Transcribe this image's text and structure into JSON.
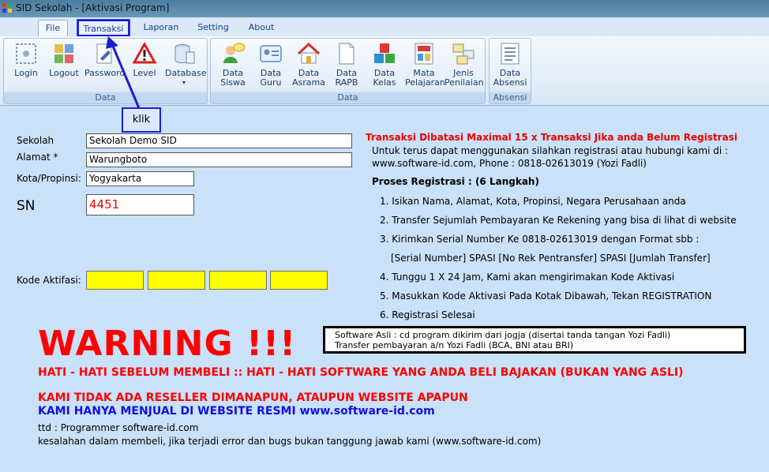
{
  "window": {
    "title": "SID Sekolah - [Aktivasi Program]"
  },
  "tabs": [
    "File",
    "Transaksi",
    "Laporan",
    "Setting",
    "About"
  ],
  "ribbon": {
    "group_data_1": {
      "label": "Data",
      "buttons": [
        "Login",
        "Logout",
        "Password",
        "Level",
        "Database"
      ]
    },
    "group_data_2": {
      "label": "Data",
      "buttons": [
        {
          "l1": "Data",
          "l2": "Siswa"
        },
        {
          "l1": "Data",
          "l2": "Guru"
        },
        {
          "l1": "Data",
          "l2": "Asrama"
        },
        {
          "l1": "Data",
          "l2": "RAPB"
        },
        {
          "l1": "Data",
          "l2": "Kelas"
        },
        {
          "l1": "Mata",
          "l2": "Pelajaran"
        },
        {
          "l1": "Jenis",
          "l2": "Penilaian"
        }
      ]
    },
    "group_absensi": {
      "label": "Absensi",
      "button": {
        "l1": "Data",
        "l2": "Absensi"
      }
    }
  },
  "callout": {
    "text": "klik"
  },
  "form": {
    "sekolah_label": "Sekolah",
    "sekolah_value": "Sekolah Demo SID",
    "alamat_label": "Alamat *",
    "alamat_value": "Warungboto",
    "kota_label": "Kota/Propinsi:",
    "kota_value": "Yogyakarta",
    "sn_label": "SN",
    "sn_value": "4451",
    "kode_label": "Kode Aktifasi:"
  },
  "info": {
    "headline": "Transaksi Dibatasi Maximal 15 x Transaksi Jika anda Belum Registrasi",
    "intro1": "Untuk terus dapat menggunakan silahkan registrasi atau hubungi kami di :",
    "intro2": "www.software-id.com, Phone : 0818-02613019 (Yozi Fadli)",
    "proses": "Proses Registrasi : (6 Langkah)",
    "steps": [
      "1. Isikan Nama, Alamat, Kota, Propinsi, Negara Perusahaan anda",
      "2. Transfer Sejumlah Pembayaran Ke Rekening yang bisa di lihat di website",
      "3. Kirimkan Serial Number Ke 0818-02613019 dengan Format sbb :",
      "[Serial Number] SPASI [No Rek Pentransfer] SPASI [Jumlah Transfer]",
      "4. Tunggu 1 X 24 Jam, Kami akan mengirimakan Kode Aktivasi",
      "5. Masukkan Kode Aktivasi Pada Kotak Dibawah, Tekan REGISTRATION",
      "6. Registrasi Selesai"
    ]
  },
  "notebox": {
    "line1": "Software Asli : cd program dikirim dari jogja (disertai tanda tangan Yozi Fadli)",
    "line2": "Transfer pembayaran a/n Yozi Fadli (BCA, BNI atau BRI)"
  },
  "warning": {
    "title": "WARNING !!!",
    "line1": "HATI - HATI SEBELUM MEMBELI :: HATI - HATI SOFTWARE YANG ANDA BELI BAJAKAN (BUKAN YANG ASLI)",
    "line2": "KAMI TIDAK ADA RESELLER DIMANAPUN, ATAUPUN WEBSITE APAPUN",
    "line3": "KAMI HANYA MENJUAL DI WEBSITE RESMI www.software-id.com",
    "ttd": "ttd : Programmer software-id.com",
    "disclaimer": "kesalahan dalam membeli, jika terjadi error dan bugs bukan tanggung jawab kami (www.software-id.com)"
  },
  "colors": {
    "background": "#c9e1f9",
    "warning_red": "#ff0000",
    "accent_blue": "#1010e0",
    "activation_box": "#ffff00"
  }
}
